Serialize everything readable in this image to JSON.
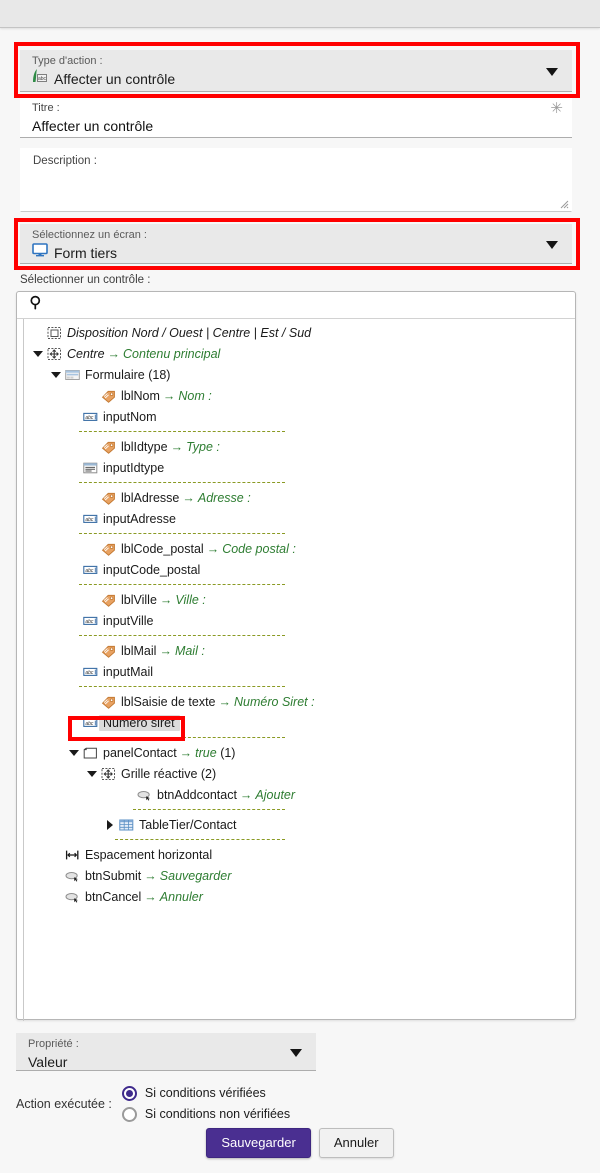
{
  "colors": {
    "highlight": "#ff0000",
    "accent": "#4a2f91",
    "tree_green": "#2e7d32",
    "dash": "#8a9a23"
  },
  "action_type": {
    "label": "Type d'action :",
    "value": "Affecter un contrôle",
    "icon": "assign-control-icon",
    "highlighted": true
  },
  "title_field": {
    "label": "Titre :",
    "value": "Affecter un contrôle",
    "required_marker": "✳"
  },
  "description_field": {
    "label": "Description :",
    "value": ""
  },
  "screen_select": {
    "label": "Sélectionnez un écran :",
    "value": "Form tiers",
    "icon": "monitor-icon",
    "highlighted": true
  },
  "control_select": {
    "label": "Sélectionner un contrôle :",
    "search_placeholder": "",
    "search_value": "",
    "search_icon": "search-icon"
  },
  "tree": [
    {
      "id": "disposition",
      "depth": 0,
      "twisty": "none",
      "icon": "layout-icon",
      "name": "Disposition Nord / Ouest | Centre | Est / Sud",
      "italic": true,
      "arrow": "",
      "target": "",
      "count": "",
      "selected": false,
      "sep_after": false
    },
    {
      "id": "centre",
      "depth": 0,
      "twisty": "open",
      "icon": "grid-move-icon",
      "name": "Centre",
      "italic": true,
      "arrow": "→",
      "target": "Contenu principal",
      "count": "",
      "selected": false,
      "sep_after": false
    },
    {
      "id": "formulaire",
      "depth": 1,
      "twisty": "open",
      "icon": "form-icon",
      "name": "Formulaire",
      "italic": false,
      "arrow": "",
      "target": "",
      "count": "(18)",
      "selected": false,
      "sep_after": false
    },
    {
      "id": "lblNom",
      "depth": 3,
      "twisty": "none",
      "icon": "tag-icon",
      "name": "lblNom",
      "italic": false,
      "arrow": "→",
      "target": "Nom :",
      "count": "",
      "selected": false,
      "sep_after": false
    },
    {
      "id": "inputNom",
      "depth": 2,
      "twisty": "none",
      "icon": "textinput-icon",
      "name": "inputNom",
      "italic": false,
      "arrow": "",
      "target": "",
      "count": "",
      "selected": false,
      "sep_after": true
    },
    {
      "id": "lblIdtype",
      "depth": 3,
      "twisty": "none",
      "icon": "tag-icon",
      "name": "lblIdtype",
      "italic": false,
      "arrow": "→",
      "target": "Type :",
      "count": "",
      "selected": false,
      "sep_after": false
    },
    {
      "id": "inputIdtype",
      "depth": 2,
      "twisty": "none",
      "icon": "list-icon",
      "name": "inputIdtype",
      "italic": false,
      "arrow": "",
      "target": "",
      "count": "",
      "selected": false,
      "sep_after": true
    },
    {
      "id": "lblAdresse",
      "depth": 3,
      "twisty": "none",
      "icon": "tag-icon",
      "name": "lblAdresse",
      "italic": false,
      "arrow": "→",
      "target": "Adresse :",
      "count": "",
      "selected": false,
      "sep_after": false
    },
    {
      "id": "inputAdresse",
      "depth": 2,
      "twisty": "none",
      "icon": "textinput-icon",
      "name": "inputAdresse",
      "italic": false,
      "arrow": "",
      "target": "",
      "count": "",
      "selected": false,
      "sep_after": true
    },
    {
      "id": "lblCode_postal",
      "depth": 3,
      "twisty": "none",
      "icon": "tag-icon",
      "name": "lblCode_postal",
      "italic": false,
      "arrow": "→",
      "target": "Code postal :",
      "count": "",
      "selected": false,
      "sep_after": false
    },
    {
      "id": "inputCode_postal",
      "depth": 2,
      "twisty": "none",
      "icon": "textinput-icon",
      "name": "inputCode_postal",
      "italic": false,
      "arrow": "",
      "target": "",
      "count": "",
      "selected": false,
      "sep_after": true
    },
    {
      "id": "lblVille",
      "depth": 3,
      "twisty": "none",
      "icon": "tag-icon",
      "name": "lblVille",
      "italic": false,
      "arrow": "→",
      "target": "Ville :",
      "count": "",
      "selected": false,
      "sep_after": false
    },
    {
      "id": "inputVille",
      "depth": 2,
      "twisty": "none",
      "icon": "textinput-icon",
      "name": "inputVille",
      "italic": false,
      "arrow": "",
      "target": "",
      "count": "",
      "selected": false,
      "sep_after": true
    },
    {
      "id": "lblMail",
      "depth": 3,
      "twisty": "none",
      "icon": "tag-icon",
      "name": "lblMail",
      "italic": false,
      "arrow": "→",
      "target": "Mail :",
      "count": "",
      "selected": false,
      "sep_after": false
    },
    {
      "id": "inputMail",
      "depth": 2,
      "twisty": "none",
      "icon": "textinput-icon",
      "name": "inputMail",
      "italic": false,
      "arrow": "",
      "target": "",
      "count": "",
      "selected": false,
      "sep_after": true
    },
    {
      "id": "lblSaisie",
      "depth": 3,
      "twisty": "none",
      "icon": "tag-icon",
      "name": "lblSaisie de texte",
      "italic": false,
      "arrow": "→",
      "target": "Numéro Siret :",
      "count": "",
      "selected": false,
      "sep_after": false
    },
    {
      "id": "numeroSiret",
      "depth": 2,
      "twisty": "none",
      "icon": "textinput-icon",
      "name": "Numéro siret",
      "italic": false,
      "arrow": "",
      "target": "",
      "count": "",
      "selected": true,
      "sep_after": true
    },
    {
      "id": "panelContact",
      "depth": 2,
      "twisty": "open",
      "icon": "panel-icon",
      "name": "panelContact",
      "italic": false,
      "arrow": "→",
      "target": "true",
      "count": "(1)",
      "selected": false,
      "sep_after": false
    },
    {
      "id": "grilleReactive",
      "depth": 3,
      "twisty": "open",
      "icon": "grid-move-icon",
      "name": "Grille réactive",
      "italic": false,
      "arrow": "",
      "target": "",
      "count": "(2)",
      "selected": false,
      "sep_after": false
    },
    {
      "id": "btnAddcontact",
      "depth": 5,
      "twisty": "none",
      "icon": "button-icon",
      "name": "btnAddcontact",
      "italic": false,
      "arrow": "→",
      "target": "Ajouter",
      "count": "",
      "selected": false,
      "sep_after": true
    },
    {
      "id": "tableTierContact",
      "depth": 4,
      "twisty": "closed",
      "icon": "table-icon",
      "name": "TableTier/Contact",
      "italic": false,
      "arrow": "",
      "target": "",
      "count": "",
      "selected": false,
      "sep_after": true
    },
    {
      "id": "espacement",
      "depth": 1,
      "twisty": "none",
      "icon": "hspace-icon",
      "name": "Espacement horizontal",
      "italic": false,
      "arrow": "",
      "target": "",
      "count": "",
      "selected": false,
      "sep_after": false
    },
    {
      "id": "btnSubmit",
      "depth": 1,
      "twisty": "none",
      "icon": "button-icon",
      "name": "btnSubmit",
      "italic": false,
      "arrow": "→",
      "target": "Sauvegarder",
      "count": "",
      "selected": false,
      "sep_after": false
    },
    {
      "id": "btnCancel",
      "depth": 1,
      "twisty": "none",
      "icon": "button-icon",
      "name": "btnCancel",
      "italic": false,
      "arrow": "→",
      "target": "Annuler",
      "count": "",
      "selected": false,
      "sep_after": false
    }
  ],
  "property_select": {
    "label": "Propriété :",
    "value": "Valeur"
  },
  "action_executed": {
    "label": "Action exécutée :",
    "options": [
      {
        "label": "Si conditions vérifiées",
        "selected": true
      },
      {
        "label": "Si conditions non vérifiées",
        "selected": false
      }
    ]
  },
  "footer": {
    "save_label": "Sauvegarder",
    "cancel_label": "Annuler"
  }
}
